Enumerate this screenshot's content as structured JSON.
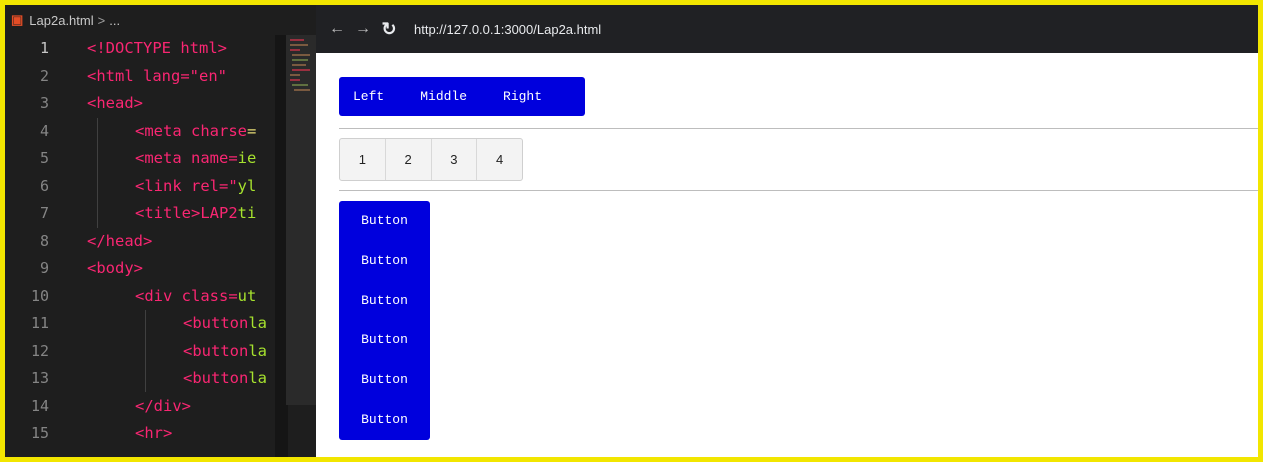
{
  "editor": {
    "breadcrumb": {
      "file": "Lap2a.html",
      "sep": ">",
      "more": "..."
    },
    "line_numbers": [
      "1",
      "2",
      "3",
      "4",
      "5",
      "6",
      "7",
      "8",
      "9",
      "10",
      "11",
      "12",
      "13",
      "14",
      "15"
    ],
    "lines": [
      {
        "parts": [
          "<!DOCTYPE html>"
        ]
      },
      {
        "parts": [
          "<html lang=\"en\""
        ]
      },
      {
        "parts": [
          "<head>"
        ]
      },
      {
        "parts": [
          "<meta charse",
          "="
        ]
      },
      {
        "parts": [
          "<meta name=",
          "ie"
        ]
      },
      {
        "parts": [
          "<link rel=\"",
          "yl"
        ]
      },
      {
        "parts": [
          "<title>LAP2",
          "ti"
        ]
      },
      {
        "parts": [
          "</head>"
        ]
      },
      {
        "parts": [
          "<body>"
        ]
      },
      {
        "parts": [
          "<div class=",
          "ut"
        ]
      },
      {
        "parts": [
          "<button",
          "la"
        ]
      },
      {
        "parts": [
          "<button",
          "la"
        ]
      },
      {
        "parts": [
          "<button",
          "la"
        ]
      },
      {
        "parts": [
          "</div>"
        ]
      },
      {
        "parts": [
          "<hr>"
        ]
      }
    ]
  },
  "browser": {
    "back_glyph": "←",
    "forward_glyph": "→",
    "reload_glyph": "↻",
    "url": "http://127.0.0.1:3000/Lap2a.html"
  },
  "page": {
    "blue_group": [
      "Left",
      "Middle",
      "Right"
    ],
    "grey_group": [
      "1",
      "2",
      "3",
      "4"
    ],
    "vertical_group": [
      "Button",
      "Button",
      "Button",
      "Button",
      "Button",
      "Button"
    ]
  },
  "colors": {
    "frame": "#f2e600",
    "button_blue": "#0000dd",
    "editor_bg": "#1e1e1e"
  }
}
